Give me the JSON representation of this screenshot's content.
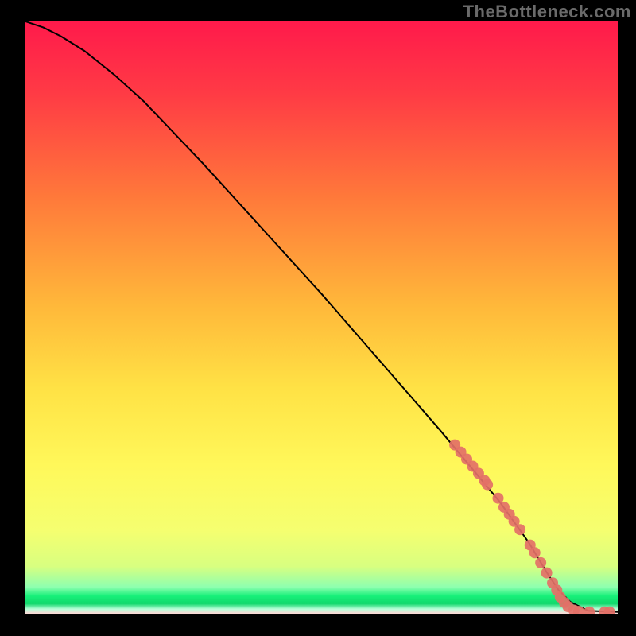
{
  "watermark": "TheBottleneck.com",
  "chart_data": {
    "type": "line",
    "title": "",
    "xlabel": "",
    "ylabel": "",
    "xlim": [
      0,
      100
    ],
    "ylim": [
      0,
      100
    ],
    "grid": false,
    "series": [
      {
        "name": "curve",
        "color": "#000000",
        "x": [
          0,
          3,
          6,
          10,
          15,
          20,
          30,
          40,
          50,
          60,
          70,
          80,
          85,
          88,
          90,
          92,
          95,
          100
        ],
        "y": [
          100,
          99,
          97.5,
          95,
          91,
          86.5,
          76,
          65,
          54,
          42.5,
          31,
          19,
          12,
          7,
          4,
          2,
          0.5,
          0.3
        ]
      }
    ],
    "scatter": {
      "name": "highlighted-points",
      "color": "#e37067",
      "points": [
        {
          "x": 72.5,
          "y": 28.5
        },
        {
          "x": 73.5,
          "y": 27.3
        },
        {
          "x": 74.5,
          "y": 26.1
        },
        {
          "x": 75.5,
          "y": 24.9
        },
        {
          "x": 76.5,
          "y": 23.7
        },
        {
          "x": 77.5,
          "y": 22.5
        },
        {
          "x": 78.0,
          "y": 21.8
        },
        {
          "x": 79.8,
          "y": 19.5
        },
        {
          "x": 80.8,
          "y": 18.0
        },
        {
          "x": 81.7,
          "y": 16.8
        },
        {
          "x": 82.5,
          "y": 15.6
        },
        {
          "x": 83.5,
          "y": 14.2
        },
        {
          "x": 85.2,
          "y": 11.6
        },
        {
          "x": 86.0,
          "y": 10.3
        },
        {
          "x": 87.0,
          "y": 8.6
        },
        {
          "x": 88.0,
          "y": 6.9
        },
        {
          "x": 89.0,
          "y": 5.2
        },
        {
          "x": 89.7,
          "y": 4.0
        },
        {
          "x": 90.3,
          "y": 2.8
        },
        {
          "x": 91.0,
          "y": 1.9
        },
        {
          "x": 91.6,
          "y": 1.2
        },
        {
          "x": 92.6,
          "y": 0.6
        },
        {
          "x": 93.4,
          "y": 0.4
        },
        {
          "x": 95.2,
          "y": 0.3
        },
        {
          "x": 97.8,
          "y": 0.3
        },
        {
          "x": 98.6,
          "y": 0.3
        }
      ],
      "radius": 7
    },
    "background_gradient": {
      "top_color": "#ff1a4b",
      "mid_colors": [
        "#ff6a3a",
        "#ffd23a",
        "#fff85a",
        "#e6ff6a"
      ],
      "green_band": "#18f07a",
      "bottom_edge": "#ffcccc"
    }
  }
}
